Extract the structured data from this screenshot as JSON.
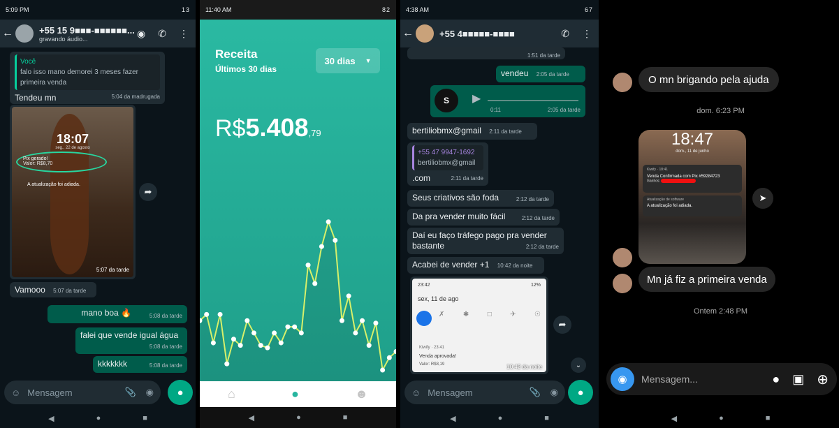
{
  "p1": {
    "status_time": "5:09 PM",
    "status_right": "13",
    "contact": "+55 15 9■■■-■■■■■■...",
    "subtitle": "gravando áudio...",
    "quote_author": "Você",
    "quote_text": "falo isso mano demorei 3 meses fazer primeira venda",
    "msg1": "Tendeu mn",
    "msg1_time": "5:04 da madrugada",
    "img_clock": "18:07",
    "img_date": "seg., 22 de agosto",
    "img_notif_title": "Pix gerado!",
    "img_notif_value": "Valor: R$8,70",
    "img_notif2": "A atualização foi adiada.",
    "img_time": "5:07 da tarde",
    "msg2": "Vamooo",
    "msg2_time": "5:07 da tarde",
    "msg3": "mano boa 🔥",
    "msg3_time": "5:08 da tarde",
    "msg4": "falei que vende igual água",
    "msg4_time": "5:08 da tarde",
    "msg5": "kkkkkkk",
    "msg5_time": "5:08 da tarde",
    "composer": "Mensagem"
  },
  "p2": {
    "status_time": "11:40 AM",
    "status_right": "82",
    "title": "Receita",
    "subtitle": "Últimos 30 dias",
    "range_label": "30 dias",
    "currency": "R$",
    "amount": "5.408",
    "cents": ",79",
    "accent": "#27b59f",
    "line_color": "#d7f06a"
  },
  "chart_data": {
    "type": "line",
    "title": "",
    "xlabel": "",
    "ylabel": "",
    "x": [
      1,
      2,
      3,
      4,
      5,
      6,
      7,
      8,
      9,
      10,
      11,
      12,
      13,
      14,
      15,
      16,
      17,
      18,
      19,
      20,
      21,
      22,
      23,
      24,
      25,
      26,
      27,
      28,
      29,
      30
    ],
    "values": [
      40,
      45,
      22,
      45,
      5,
      25,
      20,
      40,
      30,
      20,
      18,
      30,
      22,
      35,
      35,
      30,
      85,
      70,
      100,
      120,
      105,
      40,
      60,
      30,
      40,
      20,
      38,
      0,
      10,
      15
    ],
    "ylim": [
      0,
      130
    ],
    "grid": false
  },
  "p3": {
    "status_time": "4:38 AM",
    "status_right": "67",
    "contact": "+55 4■■■■■-■■■■",
    "top_time": "1:51 da tarde",
    "msg1": "vendeu",
    "msg1_time": "2:05 da tarde",
    "audio_dur": "0:11",
    "audio_time": "2:05 da tarde",
    "msg2": "bertiliobmx@gmail",
    "msg2_time": "2:11 da tarde",
    "quote_phone": "+55 47 9947-1692",
    "quote_text": "bertiliobmx@gmail",
    "msg3": ".com",
    "msg3_time": "2:11 da tarde",
    "msg4": "Seus criativos são foda",
    "msg4_time": "2:12 da tarde",
    "msg5": "Da pra vender muito fácil",
    "msg5_time": "2:12 da tarde",
    "msg6": "Daí eu faço tráfego pago pra vender bastante",
    "msg6_time": "2:12 da tarde",
    "msg7": "Acabei de vender +1",
    "msg7_time": "10:42 da noite",
    "shot_time": "23:42",
    "shot_battery": "12%",
    "shot_date": "sex, 11 de ago",
    "shot_app": "Kiwify · 23:41",
    "shot_title": "Venda aprovada!",
    "shot_value": "Valor: R$8,19",
    "shot_msg_time": "10:42 da noite",
    "composer": "Mensagem"
  },
  "p4": {
    "msg1": "O mn brigando pela ajuda",
    "sep1": "dom. 6:23 PM",
    "img_clock": "18:47",
    "img_date": "dom., 11 de junho",
    "img_app": "Kiwify · 18:41",
    "img_title": "Venda Confirmada com Pix #59284723",
    "img_value": "Ganhos:",
    "img_notif2_title": "Atualização de software",
    "img_notif2": "A atualização foi adiada.",
    "msg2": "Mn já fiz a primeira venda",
    "sep2": "Ontem 2:48 PM",
    "composer": "Mensagem..."
  }
}
